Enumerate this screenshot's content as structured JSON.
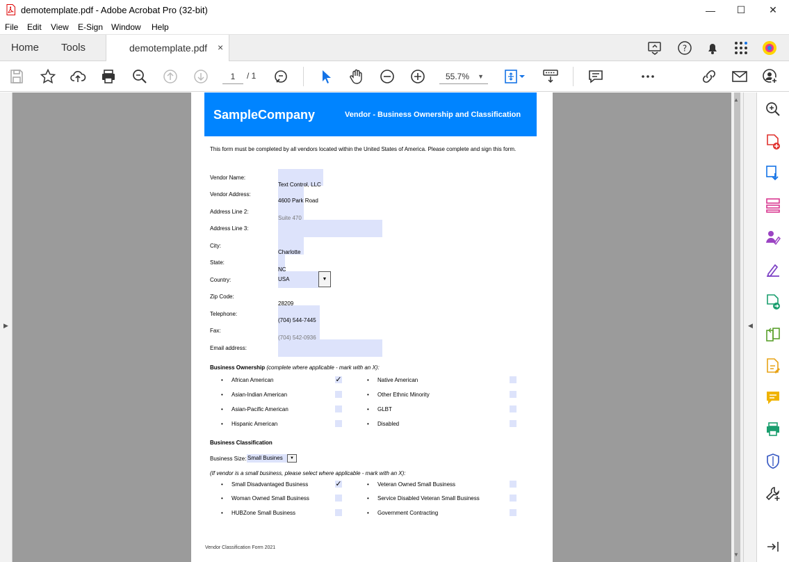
{
  "window": {
    "title": "demotemplate.pdf - Adobe Acrobat Pro (32-bit)",
    "minimize": "—",
    "maximize": "☐",
    "close": "✕"
  },
  "menu": [
    "File",
    "Edit",
    "View",
    "E-Sign",
    "Window",
    "Help"
  ],
  "tabs": {
    "home": "Home",
    "tools": "Tools",
    "document": "demotemplate.pdf",
    "close": "×"
  },
  "toolbar": {
    "page_current": "1",
    "page_total": "/ 1",
    "zoom": "55.7%"
  },
  "colors": {
    "accent": "#0084ff",
    "field_fill": "#dde3fb",
    "workspace": "#9b9b9b"
  },
  "form": {
    "company": "SampleCompany",
    "title": "Vendor - Business Ownership and Classification",
    "intro": "This form must be completed by all vendors located within the United States of America. Please complete and sign this form.",
    "fields": [
      {
        "label": "Vendor Name:",
        "value": ""
      },
      {
        "label": "Vendor Address:",
        "value": "Text Control, LLC"
      },
      {
        "label": "Address Line 2:",
        "value": "4600 Park Road"
      },
      {
        "label": "Address Line 3:",
        "value": "Suite 470"
      },
      {
        "label": "City:",
        "value": ""
      },
      {
        "label": "State:",
        "value": "Charlotte"
      },
      {
        "label": "Country:",
        "value": "NC"
      },
      {
        "label": "Zip Code:",
        "value": "USA"
      },
      {
        "label": "Telephone:",
        "value": "28209"
      },
      {
        "label": "Fax:",
        "value": "(704) 544-7445"
      },
      {
        "label": "Email address:",
        "value": "(704) 542-0936"
      }
    ],
    "ownership_heading": "Business Ownership",
    "ownership_note": "(complete where applicable - mark with an X):",
    "ownership_left": [
      {
        "label": "African American",
        "checked": "✓"
      },
      {
        "label": "Asian-Indian American",
        "checked": ""
      },
      {
        "label": "Asian-Pacific American",
        "checked": ""
      },
      {
        "label": "Hispanic American",
        "checked": ""
      }
    ],
    "ownership_right": [
      {
        "label": "Native American",
        "checked": ""
      },
      {
        "label": "Other Ethnic Minority",
        "checked": ""
      },
      {
        "label": "GLBT",
        "checked": ""
      },
      {
        "label": "Disabled",
        "checked": ""
      }
    ],
    "classification_heading": "Business Classification",
    "size_label": "Business Size:",
    "size_value": "Small Busines",
    "small_note": "(If vendor is a small business, please select where applicable - mark with an X):",
    "class_left": [
      {
        "label": "Small Disadvantaged Business",
        "checked": "✓"
      },
      {
        "label": "Woman Owned Small Business",
        "checked": ""
      },
      {
        "label": "HUBZone Small Business",
        "checked": ""
      }
    ],
    "class_right": [
      {
        "label": "Veteran Owned Small Business",
        "checked": ""
      },
      {
        "label": "Service Disabled Veteran Small Business",
        "checked": ""
      },
      {
        "label": "Government Contracting",
        "checked": ""
      }
    ],
    "footer": "Vendor Classification Form 2021"
  }
}
